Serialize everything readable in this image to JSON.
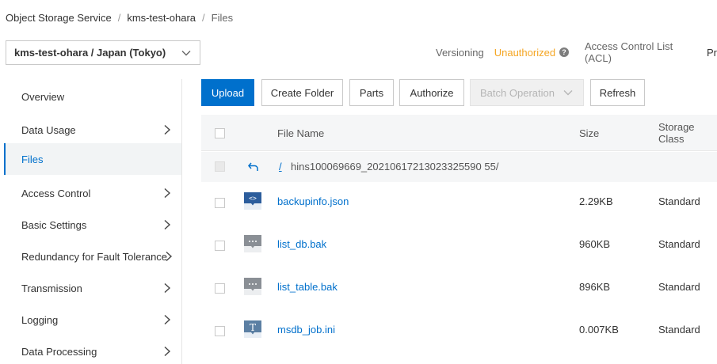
{
  "breadcrumb": {
    "service": "Object Storage Service",
    "bucket": "kms-test-ohara",
    "current": "Files"
  },
  "bucket_selector": {
    "value": "kms-test-ohara / Japan (Tokyo)"
  },
  "bucket_meta": {
    "versioning_label": "Versioning",
    "versioning_value": "Unauthorized",
    "acl_label": "Access Control List (ACL)",
    "truncated": "Pr"
  },
  "sidebar": {
    "items": [
      {
        "label": "Overview"
      },
      {
        "label": "Data Usage"
      },
      {
        "label": "Files"
      },
      {
        "label": "Access Control"
      },
      {
        "label": "Basic Settings"
      },
      {
        "label": "Redundancy for Fault Tolerance"
      },
      {
        "label": "Transmission"
      },
      {
        "label": "Logging"
      },
      {
        "label": "Data Processing"
      }
    ]
  },
  "toolbar": {
    "upload": "Upload",
    "create_folder": "Create Folder",
    "parts": "Parts",
    "authorize": "Authorize",
    "batch_operation": "Batch Operation",
    "refresh": "Refresh"
  },
  "table": {
    "headers": {
      "file_name": "File Name",
      "size": "Size",
      "storage_class": "Storage Class"
    },
    "path": {
      "root": "/",
      "folder": "hins100069669_20210617213023325590 55/"
    },
    "rows": [
      {
        "name": "backupinfo.json",
        "size": "2.29KB",
        "storage": "Standard",
        "icon": "json-file-icon"
      },
      {
        "name": "list_db.bak",
        "size": "960KB",
        "storage": "Standard",
        "icon": "generic-file-icon"
      },
      {
        "name": "list_table.bak",
        "size": "896KB",
        "storage": "Standard",
        "icon": "generic-file-icon"
      },
      {
        "name": "msdb_job.ini",
        "size": "0.007KB",
        "storage": "Standard",
        "icon": "text-file-icon"
      }
    ]
  },
  "colors": {
    "primary": "#0070cc",
    "warning": "#f5a623",
    "header_bg": "#f5f6f7"
  }
}
